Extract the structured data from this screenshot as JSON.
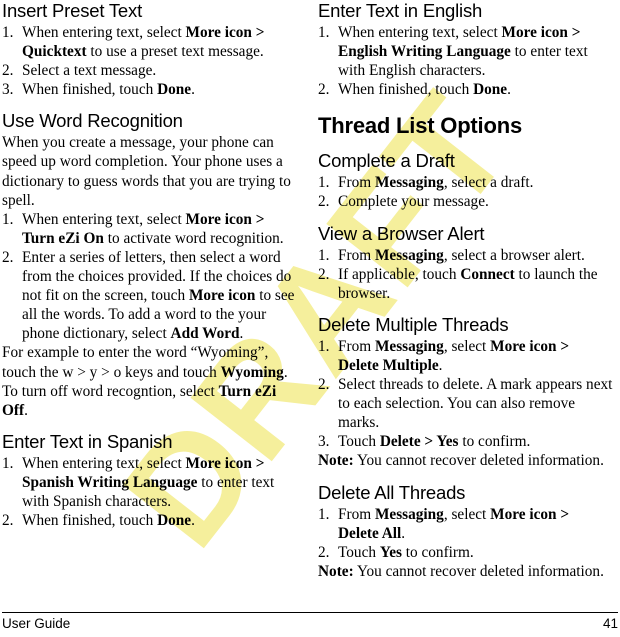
{
  "watermark": {
    "text": "DRAFT",
    "color": "#f5ef9c"
  },
  "footer": {
    "guide_label": "User Guide",
    "page_number": "41"
  },
  "left_column": {
    "sections": [
      {
        "heading": "Insert Preset Text",
        "heading_level": "h2",
        "steps": [
          {
            "num": "1.",
            "html": "When entering text, select <b>More icon &gt; Quicktext</b> to use a preset text message."
          },
          {
            "num": "2.",
            "html": "Select a text message."
          },
          {
            "num": "3.",
            "html": "When finished, touch <b>Done</b>."
          }
        ]
      },
      {
        "heading": "Use Word Recognition",
        "heading_level": "h2",
        "intro": "When you create a message, your phone can speed up word completion. Your phone uses a dictionary to guess words that you are trying to spell.",
        "steps": [
          {
            "num": "1.",
            "html": "When entering text, select <b>More icon &gt; Turn eZi On</b> to activate word recognition."
          },
          {
            "num": "2.",
            "html": "Enter a series of letters, then select a word from the choices provided. If the choices do not fit on the screen, touch <b>More icon</b> to see all the words. To add a word to the your phone dictionary, select <b>Add Word</b>."
          }
        ],
        "outro1": "For example to enter the word “Wyoming”, touch the w &gt; y &gt; o keys and touch <b>Wyoming</b>.",
        "outro2": "To turn off word recogntion, select <b>Turn eZi Off</b>."
      },
      {
        "heading": "Enter Text in Spanish",
        "heading_level": "h2",
        "steps": [
          {
            "num": "1.",
            "html": "When entering text, select <b>More icon &gt; Spanish Writing Language</b> to enter text with Spanish characters."
          },
          {
            "num": "2.",
            "html": "When finished, touch <b>Done</b>."
          }
        ]
      }
    ]
  },
  "right_column": {
    "sections": [
      {
        "heading": "Enter Text in English",
        "heading_level": "h2",
        "steps": [
          {
            "num": "1.",
            "html": "When entering text, select <b>More icon &gt; English Writing Language</b> to enter text with English characters."
          },
          {
            "num": "2.",
            "html": "When finished, touch <b>Done</b>."
          }
        ]
      },
      {
        "heading": "Thread List Options",
        "heading_level": "h1"
      },
      {
        "heading": "Complete a Draft",
        "heading_level": "h2",
        "steps": [
          {
            "num": "1.",
            "html": "From <b>Messaging</b>, select a draft."
          },
          {
            "num": "2.",
            "html": "Complete your message."
          }
        ]
      },
      {
        "heading": "View a Browser Alert",
        "heading_level": "h2",
        "steps": [
          {
            "num": "1.",
            "html": "From <b>Messaging</b>, select a browser alert."
          },
          {
            "num": "2.",
            "html": "If applicable, touch <b>Connect</b> to launch the browser."
          }
        ]
      },
      {
        "heading": "Delete Multiple Threads",
        "heading_level": "h2",
        "steps": [
          {
            "num": "1.",
            "html": "From <b>Messaging</b>, select <b>More icon &gt; Delete Multiple</b>."
          },
          {
            "num": "2.",
            "html": "Select threads to delete. A mark appears next to each selection. You can also remove marks."
          },
          {
            "num": "3.",
            "html": "Touch <b>Delete &gt; Yes</b> to confirm."
          }
        ],
        "note": "<b>Note:</b> You cannot recover deleted information."
      },
      {
        "heading": "Delete All Threads",
        "heading_level": "h2",
        "steps": [
          {
            "num": "1.",
            "html": "From <b>Messaging</b>, select <b>More icon &gt; Delete All</b>."
          },
          {
            "num": "2.",
            "html": "Touch <b>Yes</b> to confirm."
          }
        ],
        "note": "<b>Note:</b> You cannot recover deleted information."
      }
    ]
  }
}
